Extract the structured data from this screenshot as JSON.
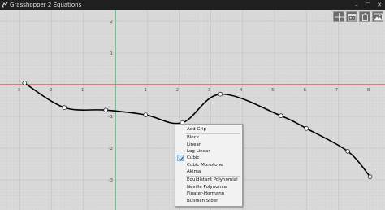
{
  "window": {
    "title": "Grasshopper 2 Equations",
    "minimize_glyph": "–",
    "maximize_glyph": "□",
    "close_glyph": "✕"
  },
  "toolbar": {
    "icons": [
      "crosshair-icon",
      "calendar-icon",
      "trash-icon",
      "image-icon"
    ]
  },
  "axes": {
    "x_ticks": [
      "-3",
      "-2",
      "-1",
      "0",
      "1",
      "2",
      "3",
      "4",
      "5",
      "6",
      "7",
      "8"
    ],
    "y_ticks": [
      "2",
      "1",
      "0",
      "-1",
      "-2",
      "-3"
    ],
    "y_axis_color": "#1f9e5a",
    "x_axis_color": "#d9232d",
    "curve_color": "#000000"
  },
  "curve": {
    "grips": [
      {
        "x": -2.85,
        "y": 0.05
      },
      {
        "x": -1.6,
        "y": -0.72
      },
      {
        "x": -0.3,
        "y": -0.8
      },
      {
        "x": 0.95,
        "y": -0.95
      },
      {
        "x": 2.1,
        "y": -1.2
      },
      {
        "x": 3.3,
        "y": -0.3
      },
      {
        "x": 5.2,
        "y": -0.98
      },
      {
        "x": 6.0,
        "y": -1.38
      },
      {
        "x": 7.3,
        "y": -2.1
      },
      {
        "x": 8.0,
        "y": -2.9
      }
    ]
  },
  "context_menu": {
    "items": [
      {
        "label": "Add Grip",
        "checked": false,
        "group_end": true
      },
      {
        "label": "Block",
        "checked": false
      },
      {
        "label": "Linear",
        "checked": false
      },
      {
        "label": "Log Linear",
        "checked": false
      },
      {
        "label": "Cubic",
        "checked": true
      },
      {
        "label": "Cubic Monotone",
        "checked": false
      },
      {
        "label": "Akima",
        "checked": false,
        "group_end": true
      },
      {
        "label": "Equidistant Polynomial",
        "checked": false
      },
      {
        "label": "Neville Polynomial",
        "checked": false
      },
      {
        "label": "Floater-Hormann",
        "checked": false
      },
      {
        "label": "Bulirsch Stoer",
        "checked": false
      }
    ]
  }
}
